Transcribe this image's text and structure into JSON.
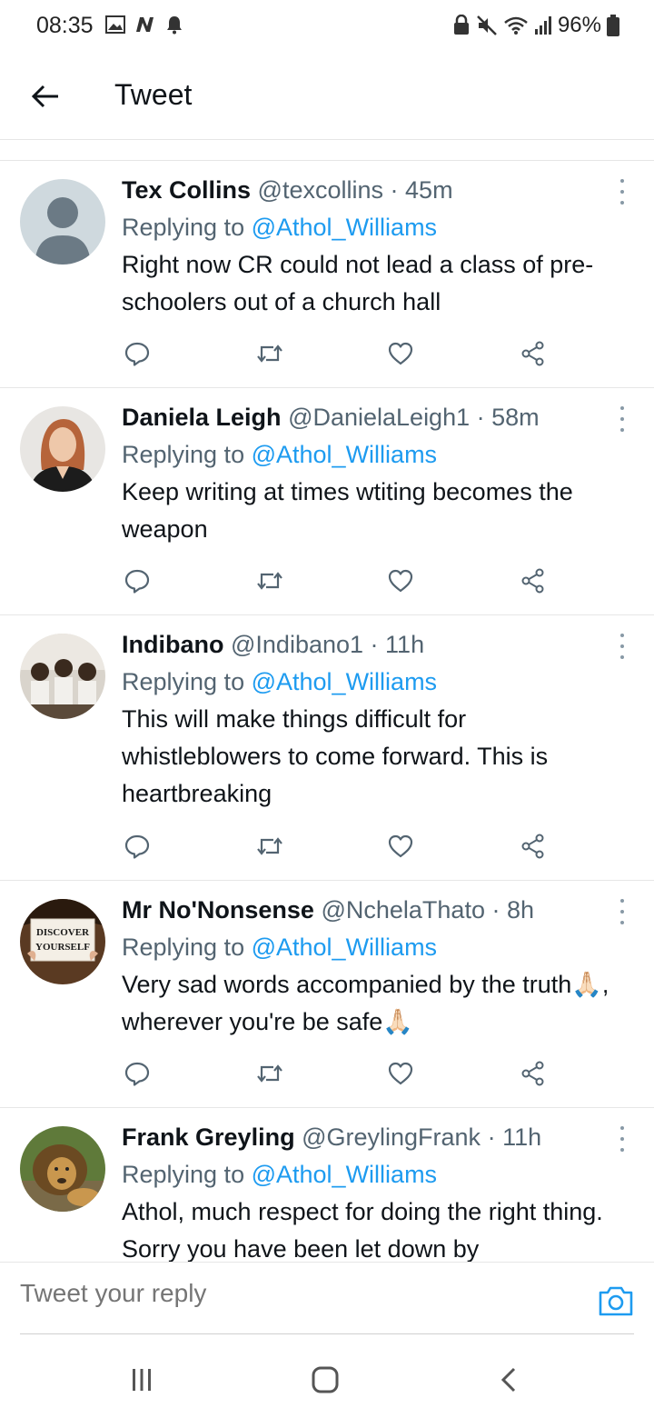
{
  "status_bar": {
    "time": "08:35",
    "battery": "96%",
    "icons_left": [
      "gallery-icon",
      "n-app-icon",
      "notification-bell-icon"
    ],
    "icons_right": [
      "lock-icon",
      "mute-icon",
      "wifi-icon",
      "signal-icon",
      "battery-icon"
    ]
  },
  "app_bar": {
    "title": "Tweet"
  },
  "tweets": [
    {
      "name": "Tex Collins",
      "handle": "@texcollins",
      "time": "45m",
      "replying_prefix": "Replying to",
      "replying_to": "@Athol_Williams",
      "text": "Right now CR could not lead a class of pre-schoolers out of a church hall"
    },
    {
      "name": "Daniela Leigh",
      "handle": "@DanielaLeigh1",
      "time": "58m",
      "replying_prefix": "Replying to",
      "replying_to": "@Athol_Williams",
      "text": "Keep writing at times wtiting becomes the weapon"
    },
    {
      "name": "Indibano",
      "handle": "@Indibano1",
      "time": "11h",
      "replying_prefix": "Replying to",
      "replying_to": "@Athol_Williams",
      "text": "This will make things difficult for whistleblowers to come forward. This is heartbreaking"
    },
    {
      "name": "Mr No'Nonsense",
      "handle": "@NchelaThato",
      "time": "8h",
      "replying_prefix": "Replying to",
      "replying_to": "@Athol_Williams",
      "text": "Very sad words accompanied by the truth🙏🏻, wherever you're be safe🙏🏻",
      "avatar_text_1": "DISCOVER",
      "avatar_text_2": "YOURSELF"
    },
    {
      "name": "Frank Greyling",
      "handle": "@GreylingFrank",
      "time": "11h",
      "replying_prefix": "Replying to",
      "replying_to": "@Athol_Williams",
      "text": "Athol, much respect for doing the right thing. Sorry you have been let down by"
    }
  ],
  "reply_bar": {
    "placeholder": "Tweet your reply"
  },
  "colors": {
    "accent": "#1d9bf0",
    "text_primary": "#0f1419",
    "text_secondary": "#536471",
    "divider": "#e6e6e6"
  }
}
